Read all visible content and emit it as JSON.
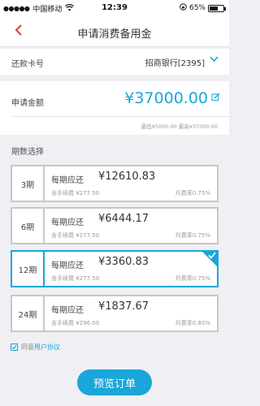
{
  "status_bar": {
    "signal": "●●●●●",
    "carrier": "中国移动",
    "wifi_icon": "wifi-icon",
    "time": "12:39",
    "battery": "65%",
    "battery_level": 0.65
  },
  "nav": {
    "title": "申请消费备用金"
  },
  "repay_account": {
    "label": "还款卡号",
    "value": "招商银行[2395]"
  },
  "amount": {
    "label": "申请金额",
    "value": "¥37000.00",
    "range": "最低¥5000.00  最高¥37000.00"
  },
  "periods": {
    "title": "期数选择",
    "items": [
      {
        "num": "3期",
        "pay_label": "每期应还",
        "pay_amount": "¥12610.83",
        "fee": "含手续费 ¥277.50",
        "rate": "月费率0.75%",
        "selected": false
      },
      {
        "num": "6期",
        "pay_label": "每期应还",
        "pay_amount": "¥6444.17",
        "fee": "含手续费 ¥277.50",
        "rate": "月费率0.75%",
        "selected": false
      },
      {
        "num": "12期",
        "pay_label": "每期应还",
        "pay_amount": "¥3360.83",
        "fee": "含手续费 ¥277.50",
        "rate": "月费率0.75%",
        "selected": true
      },
      {
        "num": "24期",
        "pay_label": "每期应还",
        "pay_amount": "¥1837.67",
        "fee": "含手续费 ¥296.00",
        "rate": "月费率0.80%",
        "selected": false
      }
    ]
  },
  "agreement": {
    "checked": true,
    "text": "同意",
    "link": "用户协议"
  },
  "submit": {
    "label": "预览订单"
  },
  "colors": {
    "accent": "#1aa6d9",
    "back": "#e03a3a"
  }
}
